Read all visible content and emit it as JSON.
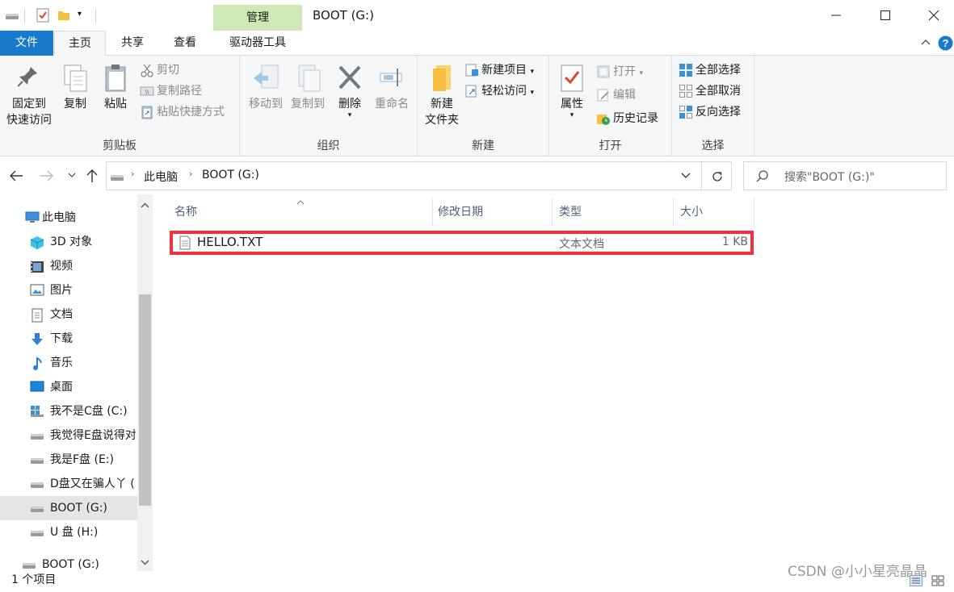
{
  "window": {
    "title": "BOOT (G:)",
    "contextual_tab_header": "管理"
  },
  "tabs": [
    {
      "label": "文件"
    },
    {
      "label": "主页"
    },
    {
      "label": "共享"
    },
    {
      "label": "查看"
    },
    {
      "label": "驱动器工具"
    }
  ],
  "ribbon": {
    "clipboard": {
      "label": "剪贴板",
      "pin_line1": "固定到",
      "pin_line2": "快速访问",
      "copy": "复制",
      "paste": "粘贴",
      "cut": "剪切",
      "copy_path": "复制路径",
      "paste_shortcut": "粘贴快捷方式"
    },
    "organize": {
      "label": "组织",
      "move_to": "移动到",
      "copy_to": "复制到",
      "delete": "删除",
      "rename": "重命名"
    },
    "new": {
      "label": "新建",
      "new_folder_line1": "新建",
      "new_folder_line2": "文件夹",
      "new_item": "新建项目",
      "easy_access": "轻松访问"
    },
    "open": {
      "label": "打开",
      "properties": "属性",
      "open": "打开",
      "edit": "编辑",
      "history": "历史记录"
    },
    "select": {
      "label": "选择",
      "select_all": "全部选择",
      "select_none": "全部取消",
      "invert": "反向选择"
    }
  },
  "address": {
    "crumbs": [
      "此电脑",
      "BOOT (G:)"
    ],
    "search_placeholder": "搜索\"BOOT (G:)\""
  },
  "nav": {
    "items": [
      {
        "label": "此电脑"
      },
      {
        "label": "3D 对象"
      },
      {
        "label": "视频"
      },
      {
        "label": "图片"
      },
      {
        "label": "文档"
      },
      {
        "label": "下载"
      },
      {
        "label": "音乐"
      },
      {
        "label": "桌面"
      },
      {
        "label": "我不是C盘 (C:)"
      },
      {
        "label": "我觉得E盘说得对"
      },
      {
        "label": "我是F盘 (E:)"
      },
      {
        "label": "D盘又在骗人丫 ("
      },
      {
        "label": "BOOT (G:)"
      },
      {
        "label": "U 盘 (H:)"
      },
      {
        "label": "BOOT (G:)"
      }
    ]
  },
  "columns": [
    "名称",
    "修改日期",
    "类型",
    "大小"
  ],
  "files": [
    {
      "name": "HELLO.TXT",
      "modified": "",
      "type": "文本文档",
      "size": "1 KB"
    }
  ],
  "status": {
    "count": "1 个项目",
    "watermark": "CSDN @小小星亮晶晶"
  },
  "colors": {
    "file_tab": "#1979ca",
    "manage_tab": "#cfe9b6",
    "highlight_box": "#f0303a",
    "selected_nav": "#e5e5e5"
  }
}
